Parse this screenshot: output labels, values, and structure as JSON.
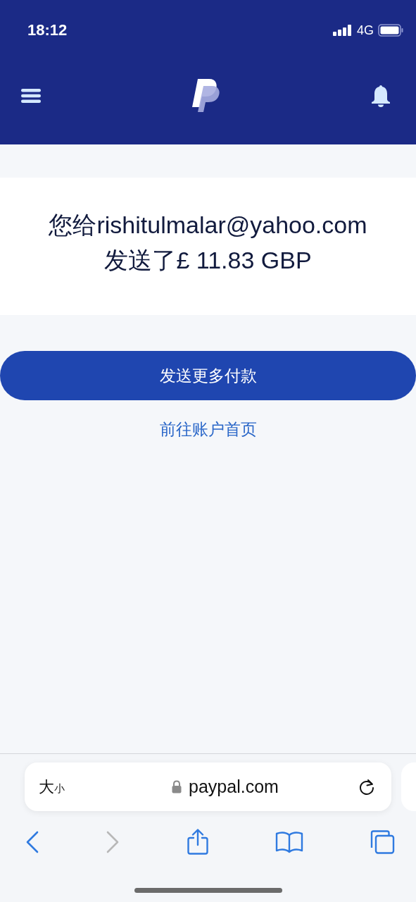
{
  "status_bar": {
    "time": "18:12",
    "network": "4G"
  },
  "header": {
    "kind": "app-bar"
  },
  "confirmation": {
    "lines": [
      "您给rishitulmalar@yahoo.com",
      "发送了£ 11.83 GBP"
    ]
  },
  "primary_button": {
    "label": "发送更多付款"
  },
  "link": {
    "label": "前往账户首页"
  },
  "browser": {
    "text_size": {
      "large": "大",
      "small": "小"
    },
    "url": "paypal.com",
    "toolbar": [
      {
        "kind": "back",
        "disabled": false
      },
      {
        "kind": "forward",
        "disabled": true
      },
      {
        "kind": "share",
        "disabled": false
      },
      {
        "kind": "bookmarks",
        "disabled": false
      },
      {
        "kind": "tabs",
        "disabled": false
      }
    ]
  }
}
